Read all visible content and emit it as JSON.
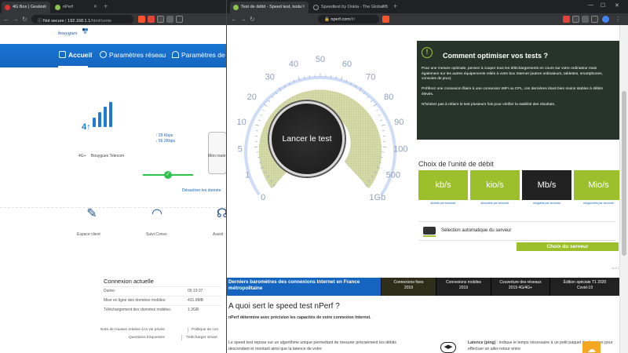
{
  "left_window": {
    "tabs": [
      {
        "title": "4G Box | Gestion",
        "active": true
      },
      {
        "title": "nPerf",
        "active": false
      }
    ],
    "address": {
      "security": "Not secure",
      "url": "192.168.1.1",
      "url_path": "/html/conte"
    },
    "brand": "bouygues",
    "nav": [
      {
        "label": "Accueil",
        "icon": "home-icon",
        "active": true
      },
      {
        "label": "Paramètres réseau",
        "icon": "globe-icon"
      },
      {
        "label": "Paramètres de b",
        "icon": "wifi-icon"
      }
    ],
    "network": {
      "badge": "4G+",
      "operator": "Bouygues Telecom",
      "signal": "signal-bars-icon"
    },
    "speeds": {
      "up": "29 Kbps",
      "down": "56.2Kbps"
    },
    "router_label": "Mon route",
    "disable_link": "Désactiver les donnée",
    "shortcuts": [
      {
        "label": "Espace client",
        "icon": "user-edit-icon"
      },
      {
        "label": "Suivi Conso",
        "icon": "gauge-icon"
      },
      {
        "label": "Assist",
        "icon": "headset-icon"
      }
    ],
    "connection": {
      "title": "Connexion actuelle",
      "rows": [
        {
          "label": "Durée:",
          "value": "05:19:37"
        },
        {
          "label": "Mise en ligne des données mobiles:",
          "value": "431.9MB"
        },
        {
          "label": "Téléchargement des données mobiles:",
          "value": "1.3GB"
        }
      ]
    },
    "footer": {
      "row1": [
        "Note de Huawei relative à la vie privée",
        "Politique de con"
      ],
      "row2": [
        "Questions fréquentes",
        "Télécharger Smart"
      ]
    }
  },
  "right_window": {
    "tabs": [
      {
        "title": "Test de débit - Speed test, testu",
        "active": true
      },
      {
        "title": "Speedtest by Ookla - The Global B",
        "active": false
      }
    ],
    "address": {
      "url": "nperf.com",
      "url_path": "/fr/"
    },
    "gauge": {
      "button_label": "Lancer le test",
      "tick_labels": [
        "0",
        "1",
        "5",
        "10",
        "20",
        "30",
        "40",
        "50",
        "60",
        "70",
        "80",
        "90",
        "100",
        "500",
        "1Gb"
      ]
    },
    "tips": {
      "title": "Comment optimiser vos tests ?",
      "paragraphs": [
        "Pour une mesure optimale, pensez à couper tous les téléchargements en cours sur votre ordinateur mais également sur les autres équipements reliés à votre box Internet (autres ordinateurs, tablettes, smartphones, consoles de jeux).",
        "Préférez une connexion filaire à une connexion WiFi ou CPL, ces dernières étant bien moins stables à débits élevés.",
        "N'hésitez pas à refaire le test plusieurs fois pour vérifier la stabilité des résultats."
      ]
    },
    "units": {
      "title": "Choix de l'unité de débit",
      "options": [
        {
          "label": "kb/s",
          "caption": "kilobits par seconde",
          "selected": false
        },
        {
          "label": "kio/s",
          "caption": "kilooctets par seconde",
          "selected": false
        },
        {
          "label": "Mb/s",
          "caption": "mégabits par seconde",
          "selected": true
        },
        {
          "label": "Mio/s",
          "caption": "mégaoctets par seconde",
          "selected": false
        }
      ]
    },
    "server": {
      "label": "Sélection automatique du serveur",
      "button": "Choix du serveur"
    },
    "version": "v2.6.2",
    "barometer": {
      "title": "Derniers baromètres des connexions Internet en France métropolitaine",
      "cells": [
        {
          "line1": "Connexions fixes",
          "line2": "2019"
        },
        {
          "line1": "Connexions mobiles",
          "line2": "2019"
        },
        {
          "line1": "Couverture des réseaux",
          "line2": "2019 4G/4G+"
        },
        {
          "line1": "Édition spéciale T1 2020",
          "line2": "Covid-19"
        }
      ]
    },
    "about": {
      "title": "A quoi sert le speed test nPerf ?",
      "subtitle": "nPerf détermine avec précision les capacités de votre connexion Internet.",
      "para_left": "Le speed test repose sur un algorithme unique permettant de mesurer précisément les débits descendant et montant ainsi que la latence de votre",
      "para_right_bold": "Latence (ping)",
      "para_right": " : indique le temps nécessaire à un petit paquet de données pour effectuer un aller-retour entre"
    }
  },
  "colors": {
    "bouygues_blue": "#1565c0",
    "nperf_green": "#9cbf2c",
    "nperf_dark": "#27342a",
    "unit_selected": "#222222",
    "cloud_orange": "#f5a623"
  }
}
